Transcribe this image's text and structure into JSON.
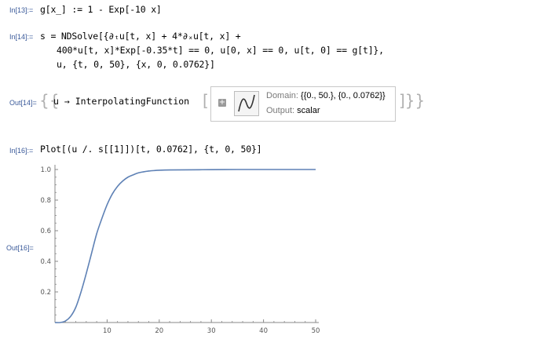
{
  "cells": {
    "in13": {
      "label": "In[13]:=",
      "code": "g[x_] := 1 - Exp[-10 x]"
    },
    "in14": {
      "label": "In[14]:=",
      "line1": "s = NDSolve[{∂ₜu[t, x] + 4*∂ₓu[t, x] +",
      "line2": "400*u[t, x]*Exp[-0.35*t] == 0, u[0, x] == 0, u[t, 0] == g[t]},",
      "line3": "u, {t, 0, 50}, {x, 0, 0.0762}]"
    },
    "out14": {
      "label": "Out[14]=",
      "rule": "u → InterpolatingFunction",
      "summary": {
        "domain_key": "Domain:",
        "domain_value": "{{0., 50.}, {0., 0.0762}}",
        "output_key": "Output:",
        "output_value": "scalar"
      }
    },
    "in16": {
      "label": "In[16]:=",
      "code": "Plot[(u /. s[[1]])[t, 0.0762], {t, 0, 50}]"
    },
    "out16": {
      "label": "Out[16]="
    }
  },
  "chart_data": {
    "type": "line",
    "title": "",
    "xlabel": "",
    "ylabel": "",
    "xlim": [
      0,
      50
    ],
    "ylim": [
      0,
      1.0
    ],
    "x_ticks": [
      10,
      20,
      30,
      40,
      50
    ],
    "y_ticks": [
      0.2,
      0.4,
      0.6,
      0.8,
      1.0
    ],
    "x_tick_labels": [
      "10",
      "20",
      "30",
      "40",
      "50"
    ],
    "y_tick_labels": [
      "0.2",
      "0.4",
      "0.6",
      "0.8",
      "1.0"
    ],
    "grid": false,
    "line_color": "#5e81b5",
    "series": [
      {
        "x": [
          0,
          1,
          2,
          3,
          4,
          5,
          6,
          7,
          8,
          9,
          10,
          11,
          12,
          13,
          14,
          15,
          16,
          17,
          18,
          19,
          20,
          22,
          25,
          30,
          35,
          40,
          45,
          50
        ],
        "y": [
          0,
          0,
          0.01,
          0.04,
          0.1,
          0.2,
          0.32,
          0.45,
          0.58,
          0.68,
          0.77,
          0.84,
          0.89,
          0.925,
          0.95,
          0.965,
          0.978,
          0.985,
          0.99,
          0.993,
          0.995,
          0.997,
          0.998,
          0.999,
          1.0,
          1.0,
          1.0,
          1.0
        ]
      }
    ]
  },
  "colors": {
    "label_blue": "#3a5a9a",
    "string_green": "#008000",
    "plot_line": "#5e81b5"
  }
}
